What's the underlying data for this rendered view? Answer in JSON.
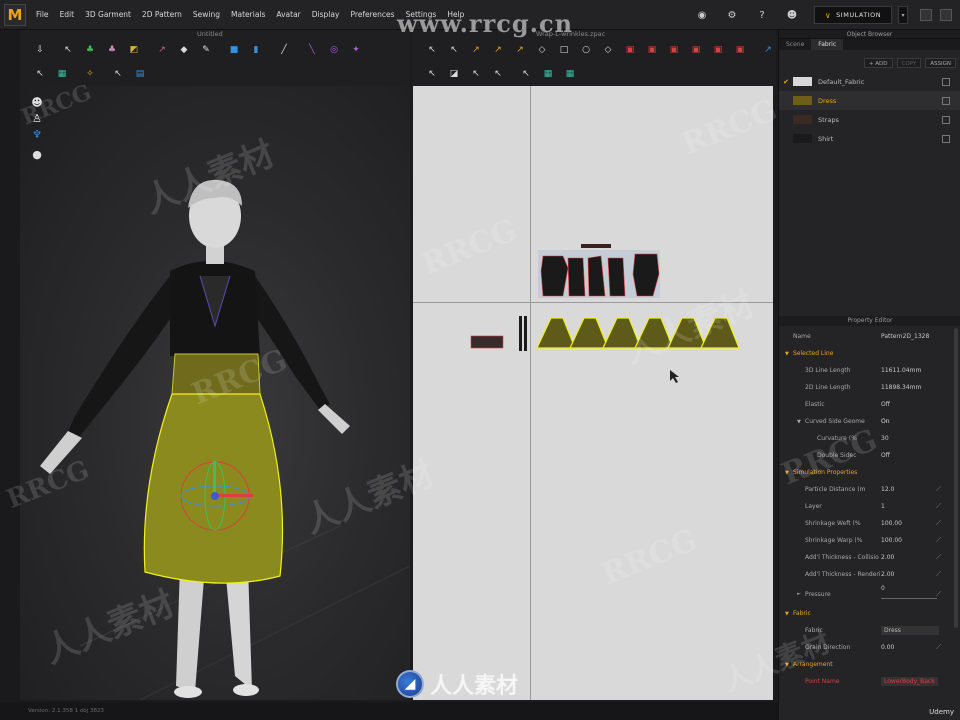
{
  "app": {
    "logo_letter": "M",
    "menu": [
      "File",
      "Edit",
      "3D Garment",
      "2D Pattern",
      "Sewing",
      "Materials",
      "Avatar",
      "Display",
      "Preferences",
      "Settings",
      "Help"
    ],
    "simulation_label": "SIMULATION",
    "toolbar_left_title": "Untitled",
    "toolbar_right_title": "Wrap-L-wrinkles.zpac"
  },
  "object_browser": {
    "title": "Object Browser",
    "tabs": [
      "Scene",
      "Fabric"
    ],
    "active_tab": "Fabric",
    "buttons": {
      "add": "+ ADD",
      "copy": "COPY",
      "assign": "ASSIGN"
    },
    "fabrics": [
      {
        "name": "Default_Fabric",
        "color": "#d8d8d8",
        "checked": true
      },
      {
        "name": "Dress",
        "color": "#6d5f1a",
        "checked": false
      },
      {
        "name": "Straps",
        "color": "#3a2a24",
        "checked": false
      },
      {
        "name": "Shirt",
        "color": "#1a1a1a",
        "checked": false
      }
    ]
  },
  "property_editor": {
    "title": "Property Editor",
    "name_label": "Name",
    "name_value": "Pattern2D_1328",
    "selected_line": {
      "section": "Selected Line",
      "line_length_3d_label": "3D Line Length",
      "line_length_3d": "11611.04mm",
      "line_length_2d_label": "2D Line Length",
      "line_length_2d": "11898.34mm",
      "elastic_label": "Elastic",
      "elastic_value": "Off",
      "curved_label": "Curved Side Geome",
      "curved_value": "On",
      "curvature_label": "Curvature (%",
      "curvature_value": "30",
      "double_label": "Double Sidec",
      "double_value": "Off"
    },
    "simulation": {
      "section": "Simulation Properties",
      "particle_label": "Particle Distance (m",
      "particle_value": "12.0",
      "layer_label": "Layer",
      "layer_value": "1",
      "weft_label": "Shrinkage Weft (%",
      "weft_value": "100.00",
      "warp_label": "Shrinkage Warp (%",
      "warp_value": "100.00",
      "collision_label": "Add'l Thickness - Collisio",
      "collision_value": "2.00",
      "render_label": "Add'l Thickness - Renderi",
      "render_value": "2.00",
      "pressure_label": "Pressure",
      "pressure_value": "0"
    },
    "fabric": {
      "section": "Fabric",
      "fabric_label": "Fabric",
      "fabric_value": "Dress",
      "grain_label": "Grain Direction",
      "grain_value": "0.00"
    },
    "arrangement": {
      "section": "Arrangement",
      "point_label": "Point Name",
      "point_value": "LowerBody_Back"
    }
  },
  "status": {
    "text": "Version: 2.1.358    1 obj 3823"
  },
  "watermarks": {
    "top": "www.rrcg.cn",
    "bottom": "人人素材",
    "tile_latin": "RRCG",
    "tile_cn": "人人素材"
  },
  "udemy_label": "Udemy",
  "colors": {
    "accent": "#e9a51c",
    "skirt": "#8a8a1e",
    "pattern_fill": "#5e5a1a",
    "pattern_outline": "#f2f21a"
  }
}
